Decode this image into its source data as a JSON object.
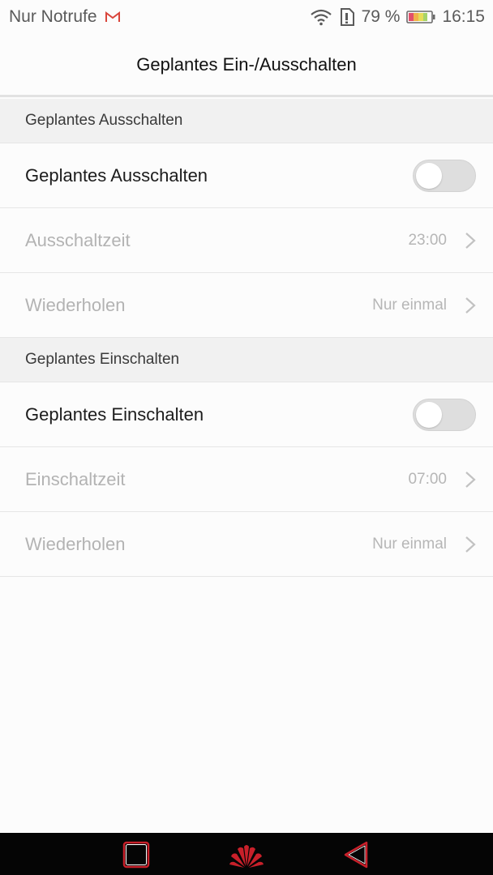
{
  "status_bar": {
    "carrier": "Nur Notrufe",
    "battery_percent": "79 %",
    "time": "16:15",
    "icons": [
      "gmail-icon",
      "wifi-icon",
      "sim-icon",
      "battery-icon"
    ]
  },
  "header": {
    "title": "Geplantes Ein-/Ausschalten"
  },
  "sections": [
    {
      "header": "Geplantes Ausschalten",
      "toggle": {
        "label": "Geplantes Ausschalten",
        "on": false
      },
      "rows": [
        {
          "label": "Ausschaltzeit",
          "value": "23:00"
        },
        {
          "label": "Wiederholen",
          "value": "Nur einmal"
        }
      ]
    },
    {
      "header": "Geplantes Einschalten",
      "toggle": {
        "label": "Geplantes Einschalten",
        "on": false
      },
      "rows": [
        {
          "label": "Einschaltzeit",
          "value": "07:00"
        },
        {
          "label": "Wiederholen",
          "value": "Nur einmal"
        }
      ]
    }
  ],
  "nav_bar": {
    "buttons": [
      "recents-square-icon",
      "home-logo-icon",
      "back-triangle-icon"
    ],
    "accent_color": "#c8202a"
  }
}
